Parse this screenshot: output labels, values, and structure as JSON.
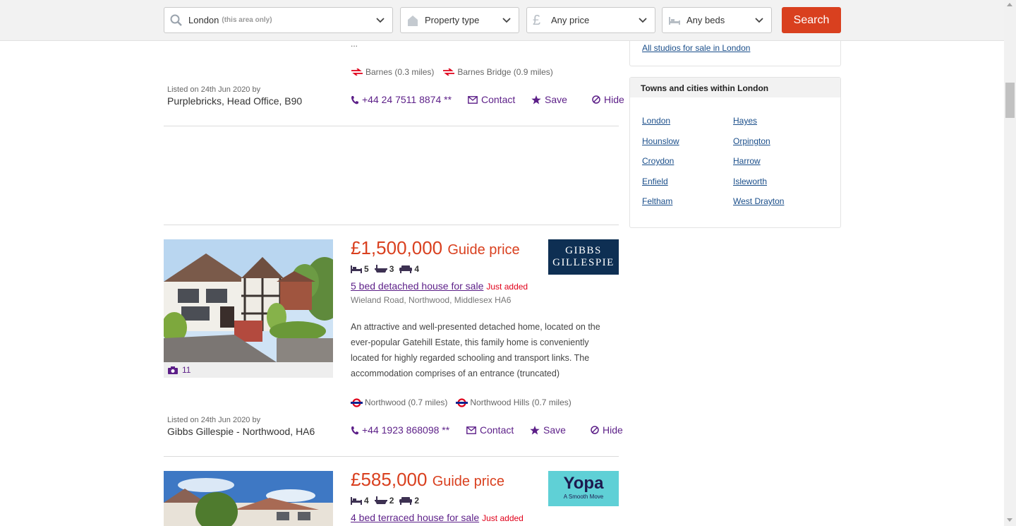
{
  "search": {
    "location": "London",
    "location_hint": "(this area only)",
    "property_type": "Property type",
    "price": "Any price",
    "beds": "Any beds",
    "button": "Search"
  },
  "listing_prev": {
    "ellipsis": "...",
    "stations": [
      "Barnes (0.3 miles)",
      "Barnes Bridge (0.9 miles)"
    ],
    "listed": "Listed on 24th Jun 2020 by",
    "agent": "Purplebricks, Head Office, B90",
    "phone": "+44 24 7511 8874 **",
    "contact": "Contact",
    "save": "Save",
    "hide": "Hide"
  },
  "listing1": {
    "price": "£1,500,000",
    "price_qualifier": "Guide price",
    "beds": "5",
    "baths": "3",
    "receptions": "4",
    "title": "5 bed detached house for sale",
    "badge": "Just added",
    "address": "Wieland Road, Northwood, Middlesex HA6",
    "description": "An attractive and well-presented detached home, located on the ever-popular Gatehill Estate, this family home is conveniently located for highly regarded schooling and transport links. The accommodation comprises of an entrance (truncated)",
    "photo_count": "11",
    "agent_logo_line1": "GIBBS",
    "agent_logo_line2": "GILLESPIE",
    "stations": [
      "Northwood (0.7 miles)",
      "Northwood Hills (0.7 miles)"
    ],
    "listed": "Listed on 24th Jun 2020 by",
    "agent": "Gibbs Gillespie - Northwood, HA6",
    "phone": "+44 1923 868098 **",
    "contact": "Contact",
    "save": "Save",
    "hide": "Hide"
  },
  "listing2": {
    "price": "£585,000",
    "price_qualifier": "Guide price",
    "beds": "4",
    "baths": "2",
    "receptions": "2",
    "title": "4 bed terraced house for sale",
    "badge": "Just added",
    "agent_logo": "Yopa",
    "agent_logo_sub": "A Smooth Move"
  },
  "sidebar": {
    "studios_link": "All studios for sale in London",
    "towns_heading": "Towns and cities within London",
    "towns_left": [
      "London",
      "Hounslow",
      "Croydon",
      "Enfield",
      "Feltham"
    ],
    "towns_right": [
      "Hayes",
      "Orpington",
      "Harrow",
      "Isleworth",
      "West Drayton"
    ]
  },
  "colors": {
    "price": "#d9401f",
    "purple": "#5c1f88",
    "search_button": "#d9401f",
    "just_added": "#e0001a",
    "link_blue": "#1a4e8a"
  }
}
